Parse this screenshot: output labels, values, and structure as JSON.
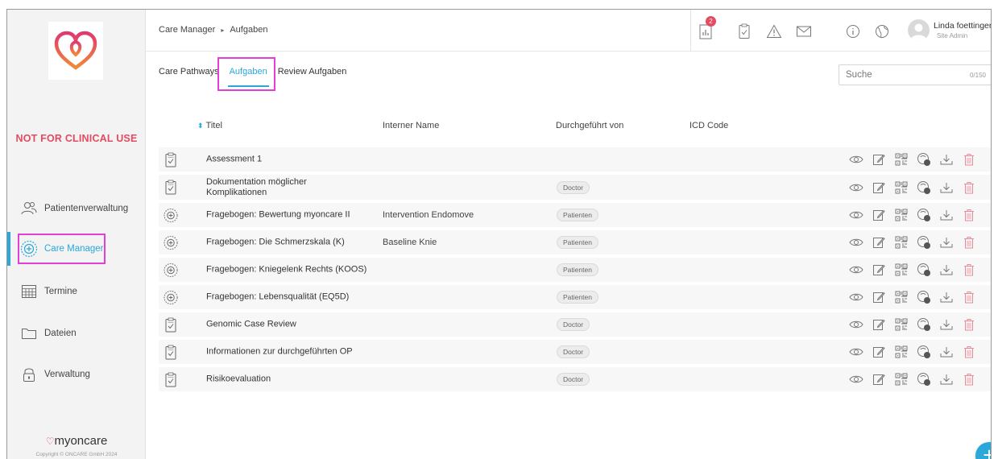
{
  "breadcrumb": {
    "root": "Care Manager",
    "current": "Aufgaben"
  },
  "header": {
    "notification_count": "2",
    "user_name": "Linda foettinger",
    "user_role": "Site Admin"
  },
  "sidebar": {
    "warning": "NOT FOR CLINICAL USE",
    "items": [
      {
        "label": "Patientenverwaltung",
        "icon": "patients-icon"
      },
      {
        "label": "Care Manager",
        "icon": "care-manager-icon",
        "active": true
      },
      {
        "label": "Termine",
        "icon": "calendar-icon"
      },
      {
        "label": "Dateien",
        "icon": "folder-icon"
      },
      {
        "label": "Verwaltung",
        "icon": "lock-icon"
      }
    ],
    "brand": "myoncare",
    "copyright": "Copyright © ONCARE GmbH 2024"
  },
  "tabs": [
    {
      "label": "Care Pathways"
    },
    {
      "label": "Aufgaben",
      "active": true
    },
    {
      "label": "Review Aufgaben"
    }
  ],
  "search": {
    "placeholder": "Suche",
    "counter": "0/150"
  },
  "table": {
    "columns": {
      "title": "Titel",
      "internal_name": "Interner Name",
      "performed_by": "Durchgeführt von",
      "icd_code": "ICD Code"
    },
    "rows": [
      {
        "icon": "clipboard-icon",
        "title": "Assessment 1",
        "internal_name": "",
        "performed_by": ""
      },
      {
        "icon": "clipboard-icon",
        "title": "Dokumentation möglicher Komplikationen",
        "internal_name": "",
        "performed_by": "Doctor"
      },
      {
        "icon": "questionnaire-icon",
        "title": "Fragebogen: Bewertung myoncare II",
        "internal_name": "Intervention Endomove",
        "performed_by": "Patienten"
      },
      {
        "icon": "questionnaire-icon",
        "title": "Fragebogen: Die Schmerzskala (K)",
        "internal_name": "Baseline Knie",
        "performed_by": "Patienten"
      },
      {
        "icon": "questionnaire-icon",
        "title": "Fragebogen: Kniegelenk Rechts (KOOS)",
        "internal_name": "",
        "performed_by": "Patienten"
      },
      {
        "icon": "questionnaire-icon",
        "title": "Fragebogen: Lebensqualität (EQ5D)",
        "internal_name": "",
        "performed_by": "Patienten"
      },
      {
        "icon": "clipboard-icon",
        "title": "Genomic Case Review",
        "internal_name": "",
        "performed_by": "Doctor"
      },
      {
        "icon": "clipboard-icon",
        "title": "Informationen zur durchgeführten OP",
        "internal_name": "",
        "performed_by": "Doctor"
      },
      {
        "icon": "clipboard-icon",
        "title": "Risikoevaluation",
        "internal_name": "",
        "performed_by": "Doctor"
      }
    ]
  },
  "colors": {
    "accent": "#2ba7d9",
    "warning": "#e44a60",
    "highlight": "#e23fd5"
  }
}
